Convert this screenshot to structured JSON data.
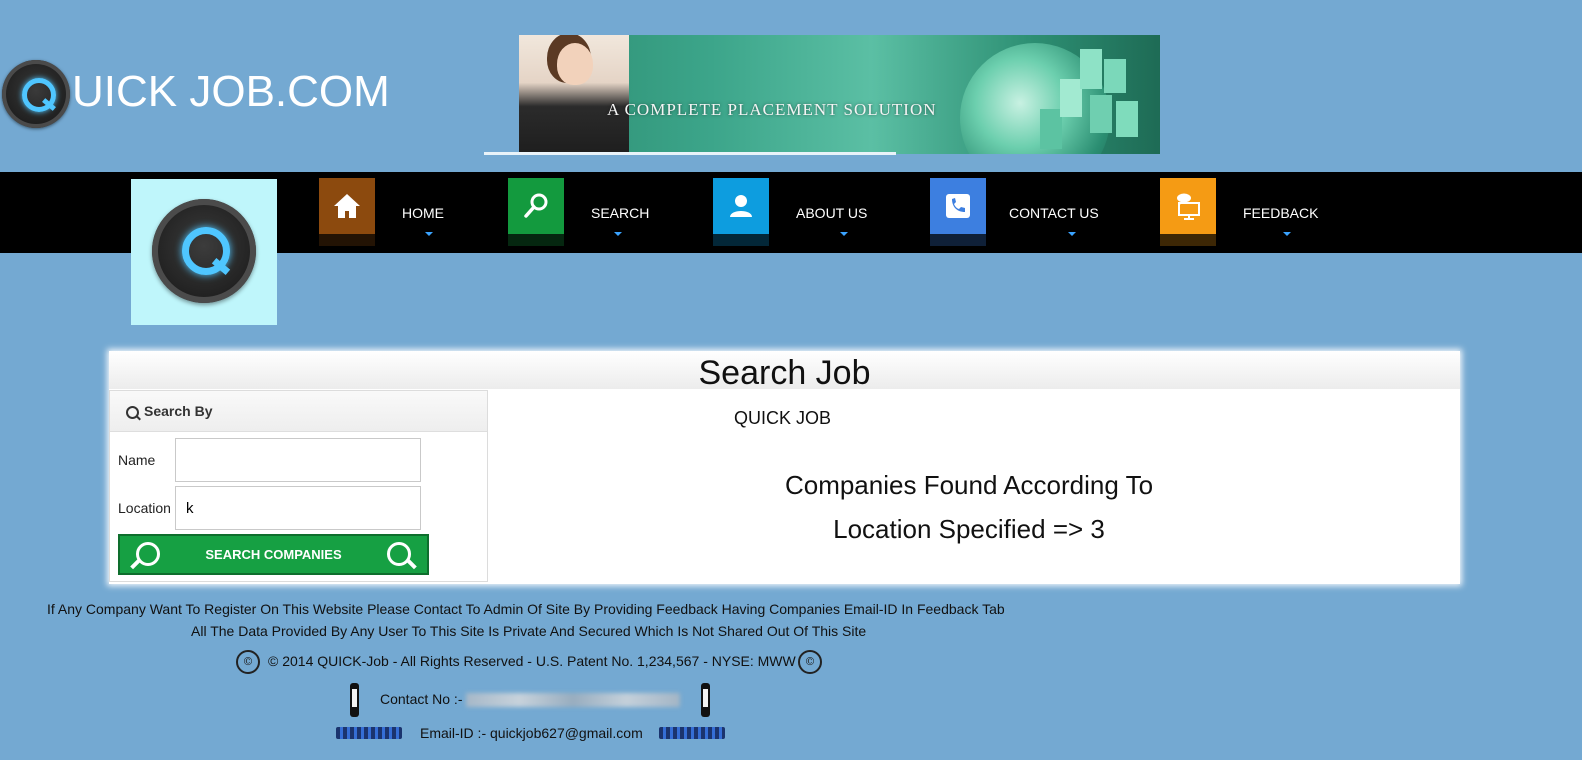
{
  "header": {
    "logo_text": "UICK JOB.COM",
    "banner_text": "A COMPLETE PLACEMENT SOLUTION"
  },
  "nav": {
    "items": [
      {
        "label": "HOME",
        "color": "#8c4a0e",
        "icon": "home-icon"
      },
      {
        "label": "SEARCH",
        "color": "#139a3e",
        "icon": "search-icon"
      },
      {
        "label": "ABOUT US",
        "color": "#0d9ddf",
        "icon": "user-icon"
      },
      {
        "label": "CONTACT US",
        "color": "#3d7fe0",
        "icon": "phone-icon"
      },
      {
        "label": "FEEDBACK",
        "color": "#f59b14",
        "icon": "monitor-chat-icon"
      }
    ]
  },
  "main": {
    "title": "Search Job",
    "subtitle": "QUICK JOB",
    "search_panel": {
      "heading": "Search By",
      "name_label": "Name",
      "name_value": "",
      "location_label": "Location",
      "location_value": "k",
      "button_label": "SEARCH COMPANIES"
    },
    "result_line1": "Companies Found According To",
    "result_line2": "Location Specified => 3"
  },
  "footer": {
    "notice1": "If Any Company Want To Register On This Website Please Contact To Admin Of Site By Providing Feedback Having Companies Email-ID In Feedback Tab",
    "notice2": "All The Data Provided By Any User To This Site Is Private And Secured Which Is Not Shared Out Of This Site",
    "copyright": "© 2014 QUICK-Job - All Rights Reserved - U.S. Patent No. 1,234,567 - NYSE: MWW",
    "contact_label": "Contact No :-",
    "email_text": "Email-ID :- quickjob627@gmail.com"
  },
  "colors": {
    "page_bg": "#74a9d2",
    "nav_bg": "#000000",
    "button_green": "#16a043"
  }
}
